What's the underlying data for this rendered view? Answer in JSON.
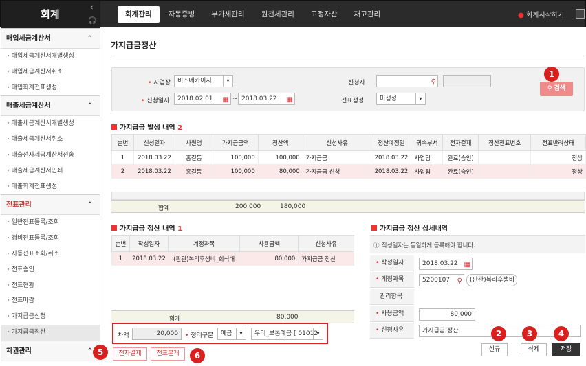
{
  "app": {
    "title": "회계",
    "right_link": "회계시작하기"
  },
  "menu": [
    "회계관리",
    "자동증빙",
    "부가세관리",
    "원천세관리",
    "고정자산",
    "재고관리"
  ],
  "sidebar": {
    "groups": [
      {
        "title": "매입세금계산서",
        "items": [
          "매입세금계산서개별생성",
          "매입세금계산서취소",
          "매입회계전표생성"
        ]
      },
      {
        "title": "매출세금계산서",
        "items": [
          "매출세금계산서개별생성",
          "매출세금계산서취소",
          "매출전자세금계산서전송",
          "매출세금계산서인쇄",
          "매출회계전표생성"
        ]
      },
      {
        "title": "전표관리",
        "items": [
          "일반전표등록/조회",
          "경비전표등록/조회",
          "자동전표조회/취소",
          "전표승인",
          "전표현황",
          "전표마감",
          "가지급금신청",
          "가지급금정산"
        ]
      },
      {
        "title": "채권관리",
        "items": []
      }
    ]
  },
  "page": {
    "title": "가지급금정산"
  },
  "search": {
    "biz_label": "사업장",
    "biz_value": "비즈메카이지",
    "date_label": "신청일자",
    "date_from": "2018.02.01",
    "date_to": "2018.03.22",
    "tilde": "~",
    "applicant_label": "신청자",
    "applicant_value": "",
    "gen_label": "전표생성",
    "gen_value": "미생성",
    "search_btn": "검색"
  },
  "occur": {
    "title": "가지급금 발생 내역",
    "count": "2",
    "headers": [
      "순번",
      "신청일자",
      "사원명",
      "가지급금액",
      "정산액",
      "신청사유",
      "정산예정일",
      "귀속부서",
      "전자결재",
      "정산전표번호",
      "전표반려상태"
    ],
    "rows": [
      [
        "1",
        "2018.03.22",
        "홍길동",
        "100,000",
        "100,000",
        "가지급금",
        "2018.03.22",
        "사업팀",
        "완료(승인)",
        "",
        "정상"
      ],
      [
        "2",
        "2018.03.22",
        "홍길동",
        "100,000",
        "80,000",
        "가지급금 신청",
        "2018.03.22",
        "사업팀",
        "완료(승인)",
        "",
        "정상"
      ]
    ],
    "sum_label": "합계",
    "sum_amount": "200,000",
    "sum_settle": "180,000"
  },
  "settle": {
    "title": "가지급금 정산 내역",
    "count": "1",
    "headers": [
      "순번",
      "작성일자",
      "계정과목",
      "사용금액",
      "신청사유"
    ],
    "rows": [
      [
        "1",
        "2018.03.22",
        "(판관)복리후생비_회식대",
        "80,000",
        "가지급금 정산"
      ]
    ],
    "sum_label": "합계",
    "sum_amount": "80,000"
  },
  "bottom": {
    "diff_label": "차액",
    "diff_value": "20,000",
    "type_label": "정리구분",
    "type_value": "예금",
    "account_value": "우리_보통예금 [ 01012",
    "btn_edoc": "전자결재",
    "btn_split": "전표분개"
  },
  "detail": {
    "title": "가지급금 정산 상세내역",
    "notice": "작성일자는 동일하게 등록해야 합니다.",
    "date_label": "작성일자",
    "date_value": "2018.03.22",
    "account_label": "계정과목",
    "account_code": "5200107",
    "account_name": "(판관)복리후생비",
    "mgmt_label": "관리항목",
    "amount_label": "사용금액",
    "amount_value": "80,000",
    "reason_label": "신청사유",
    "reason_value": "가지급금 정산"
  },
  "actions": {
    "new": "신규",
    "delete": "삭제",
    "save": "저장"
  },
  "badges": [
    "1",
    "2",
    "3",
    "4",
    "5",
    "6"
  ]
}
